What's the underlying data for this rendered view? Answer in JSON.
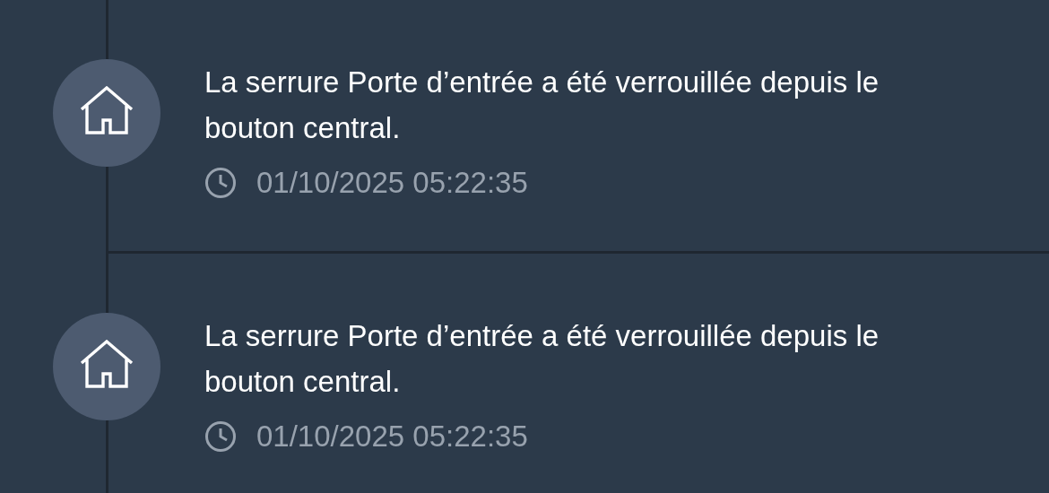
{
  "events": [
    {
      "message": "La serrure Porte d’entrée a été verrouillée depuis le bouton central.",
      "time": "01/10/2025 05:22:35"
    },
    {
      "message": "La serrure Porte d’entrée a été verrouillée depuis le bouton central.",
      "time": "01/10/2025 05:22:35"
    }
  ]
}
